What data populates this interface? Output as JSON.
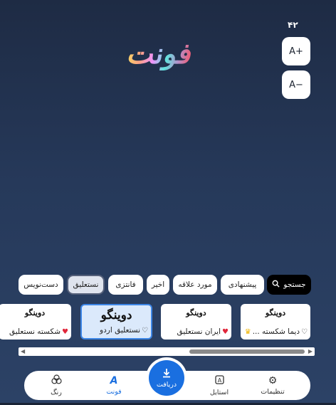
{
  "font_size": "۴۲",
  "size_buttons": {
    "increase": "A+",
    "decrease": "A−"
  },
  "preview_text": "فونت",
  "chips": {
    "search": "جستجو",
    "items": [
      "پیشنهادی",
      "مورد علاقه",
      "اخیر",
      "فانتزی",
      "نستعلیق",
      "دست‌نویس"
    ],
    "active": "نستعلیق"
  },
  "cards": [
    {
      "art": "دوینگو",
      "label": "دیما شکسته ..."
    },
    {
      "art": "دوینگو",
      "label": "ایران نستعلیق"
    },
    {
      "art": "دوینگو",
      "label": "نستعلیق اردو"
    },
    {
      "art": "دوینگو",
      "label": "شکسته نستعلیق"
    }
  ],
  "nav": {
    "settings": "تنظیمات",
    "style": "استایل",
    "receive": "دریافت",
    "font": "فونت",
    "color": "رنگ"
  },
  "colors": {
    "accent": "#1a6fe0",
    "heart": "#e0263a",
    "crown": "#f0b400"
  }
}
